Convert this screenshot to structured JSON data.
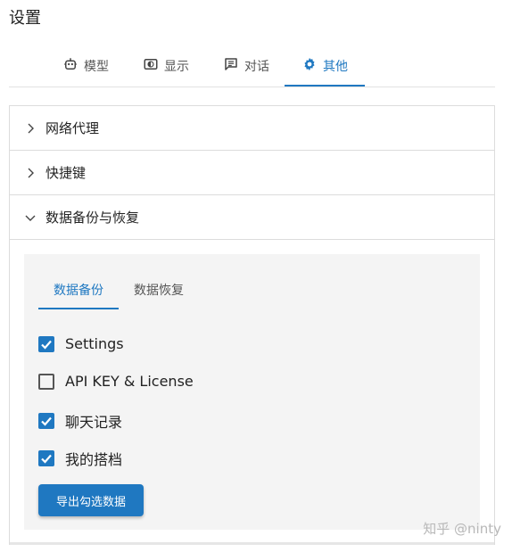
{
  "page": {
    "title": "设置"
  },
  "tabs": [
    {
      "label": "模型",
      "icon": "robot-icon",
      "active": false
    },
    {
      "label": "显示",
      "icon": "display-icon",
      "active": false
    },
    {
      "label": "对话",
      "icon": "chat-icon",
      "active": false
    },
    {
      "label": "其他",
      "icon": "gear-icon",
      "active": true
    }
  ],
  "accordion": {
    "proxy": {
      "label": "网络代理",
      "expanded": false
    },
    "shortcuts": {
      "label": "快捷键",
      "expanded": false
    },
    "backup": {
      "label": "数据备份与恢复",
      "expanded": true,
      "tabs": [
        {
          "label": "数据备份",
          "active": true
        },
        {
          "label": "数据恢复",
          "active": false
        }
      ],
      "options": [
        {
          "label": "Settings",
          "checked": true
        },
        {
          "label": "API KEY & License",
          "checked": false
        },
        {
          "label": "聊天记录",
          "checked": true
        },
        {
          "label": "我的搭档",
          "checked": true
        }
      ],
      "export_label": "导出勾选数据"
    }
  },
  "watermark": "知乎 @ninty",
  "colors": {
    "accent": "#1f78c1",
    "panel": "#f4f4f4",
    "border": "#dcdcdc"
  }
}
